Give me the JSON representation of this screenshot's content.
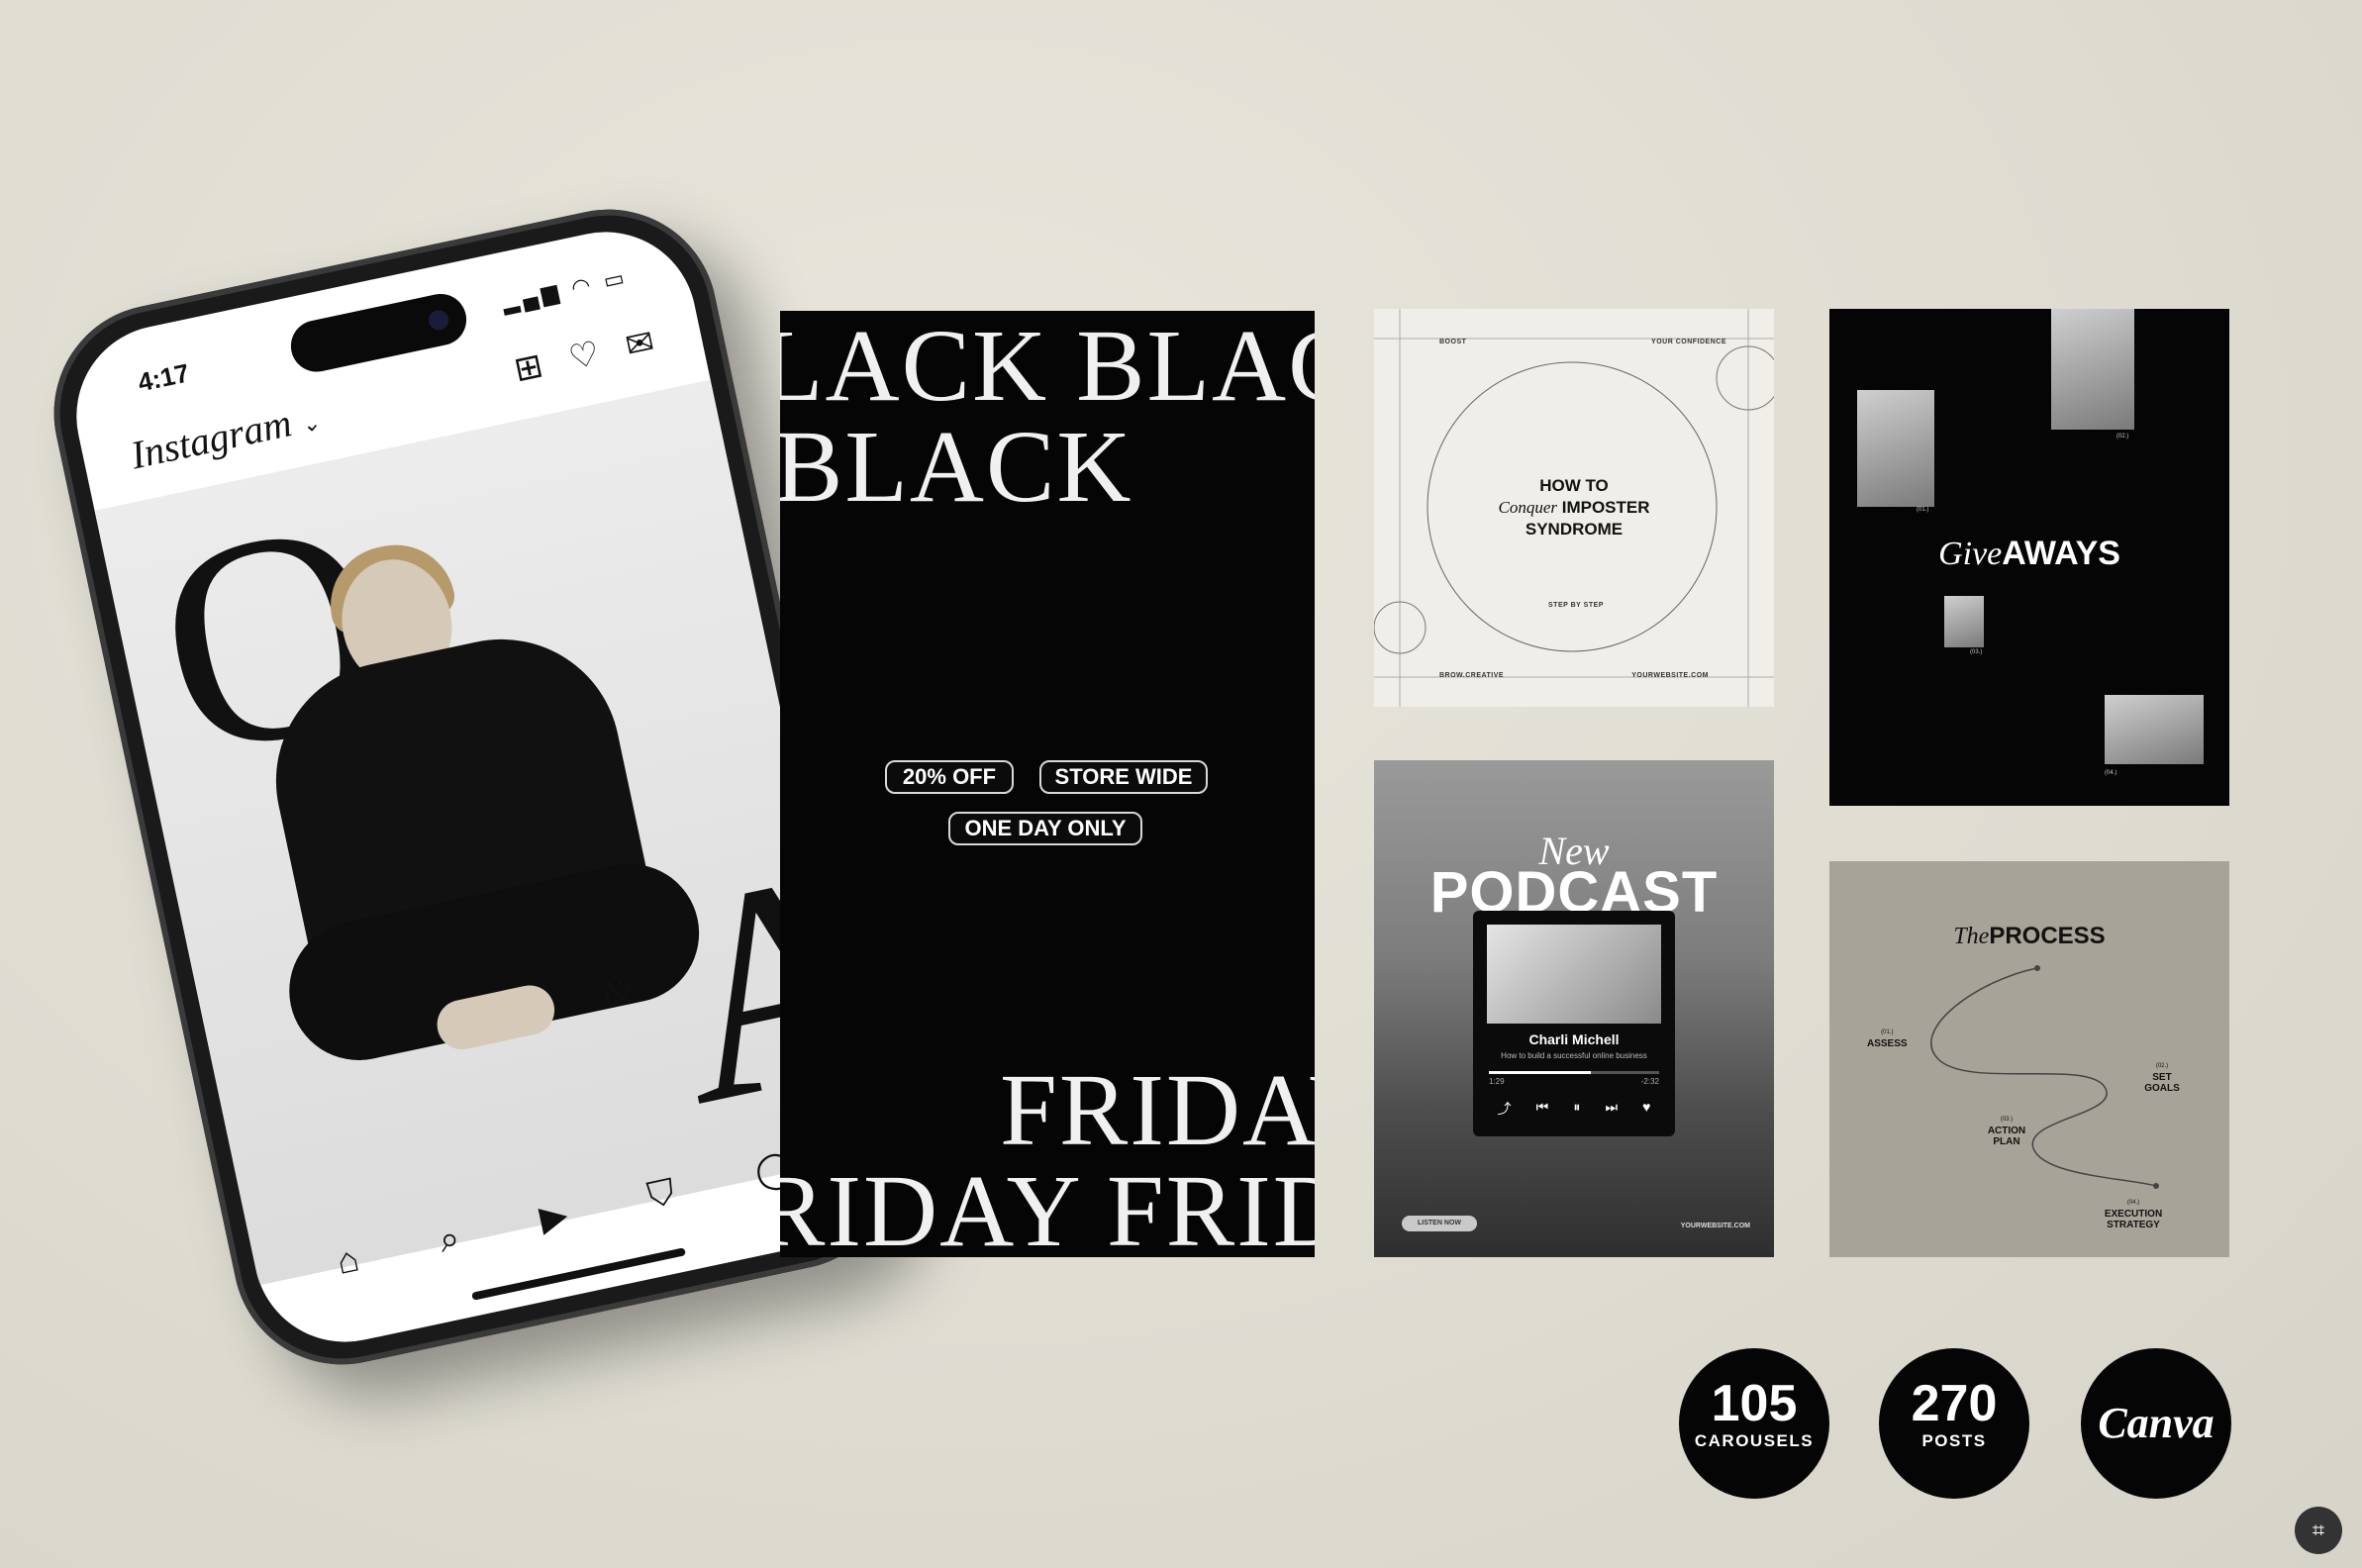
{
  "phone": {
    "time": "4:17",
    "app_name": "Instagram",
    "post": {
      "q_letter": "Q",
      "amp": "&",
      "a_letter": "A"
    }
  },
  "black_friday": {
    "top_line_1": "LACK BLACK BLACK",
    "top_line_2": "BLACK",
    "discount": "20% OFF",
    "store_wide": "STORE WIDE",
    "one_day": "ONE DAY ONLY",
    "bottom_line_1": "FRIDAY",
    "bottom_line_2": "RIDAY FRIDAY"
  },
  "imposter": {
    "corner_tl": "BOOST",
    "corner_tr": "YOUR CONFIDENCE",
    "title_line_1": "HOW TO",
    "title_line_2_script": "Conquer",
    "title_line_2_bold": "IMPOSTER",
    "title_line_3": "SYNDROME",
    "step": "STEP BY STEP",
    "corner_bl": "BROW.CREATIVE",
    "corner_br": "YOURWEBSITE.COM"
  },
  "giveaways": {
    "title_script": "Give",
    "title_bold": "AWAYS",
    "labels": [
      "(01.)",
      "(02.)",
      "(03.)",
      "(04.)"
    ]
  },
  "podcast": {
    "new_label": "New",
    "title": "PODCAST",
    "host": "Charli Michell",
    "episode": "How to build a successful online business",
    "elapsed": "1:29",
    "remaining": "-2:32",
    "progress": 0.6,
    "listen_now": "LISTEN NOW",
    "website": "YOURWEBSITE.COM"
  },
  "process": {
    "title_script": "The",
    "title_bold": "PROCESS",
    "steps": [
      {
        "n": "(01.)",
        "label": "ASSESS"
      },
      {
        "n": "(02.)",
        "label": "SET GOALS"
      },
      {
        "n": "(03.)",
        "label": "ACTION PLAN"
      },
      {
        "n": "(04.)",
        "label": "EXECUTION STRATEGY"
      }
    ]
  },
  "badges": {
    "carousels_count": "105",
    "carousels_label": "CAROUSELS",
    "posts_count": "270",
    "posts_label": "POSTS",
    "brand": "Canva"
  }
}
